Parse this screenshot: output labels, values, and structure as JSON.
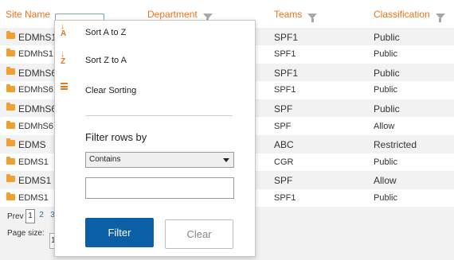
{
  "colors": {
    "header_text": "#e8741c",
    "folder": "#f0a030",
    "primary_button": "#0b5fa5",
    "row_alt": "#f2f2f2"
  },
  "columns": [
    "Site Name",
    "Department",
    "Teams",
    "Classification"
  ],
  "rows": [
    {
      "site": "EDMhS1",
      "team": "SPF1",
      "class": "Public"
    },
    {
      "site": "EDMhS1",
      "team": "SPF1",
      "class": "Public"
    },
    {
      "site": "EDMhS6",
      "team": "SPF1",
      "class": "Public"
    },
    {
      "site": "EDMhS6",
      "team": "SPF1",
      "class": "Public"
    },
    {
      "site": "EDMhS6",
      "team": "SPF",
      "class": "Public"
    },
    {
      "site": "EDMhS6",
      "team": "SPF",
      "class": "Allow"
    },
    {
      "site": "EDMS",
      "team": "ABC",
      "class": "Restricted"
    },
    {
      "site": "EDMS1",
      "team": "CGR",
      "class": "Public"
    },
    {
      "site": "EDMS1",
      "team": "SPF",
      "class": "Allow"
    },
    {
      "site": "EDMS1",
      "team": "SPF1",
      "class": "Public"
    }
  ],
  "pager": {
    "prev": "Prev",
    "pages": [
      "1",
      "2",
      "3"
    ],
    "current": "1",
    "page_size_label": "Page size:",
    "page_size_value": "1"
  },
  "popup": {
    "sort_asc": "Sort A to Z",
    "sort_desc": "Sort Z to A",
    "clear_sorting": "Clear Sorting",
    "filter_title": "Filter rows by",
    "operator": "Contains",
    "operator_options": [
      "Contains"
    ],
    "filter_value": "",
    "filter_button": "Filter",
    "clear_button": "Clear",
    "icons": [
      "sort-ascending-icon",
      "sort-descending-icon",
      "clear-sort-icon"
    ]
  }
}
